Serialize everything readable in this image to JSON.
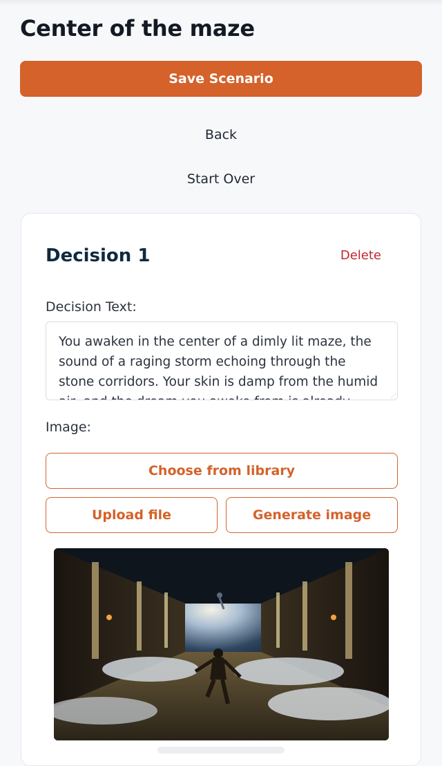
{
  "header": {
    "title": "Center of the maze"
  },
  "actions": {
    "save_label": "Save Scenario",
    "back_label": "Back",
    "start_over_label": "Start Over"
  },
  "decision": {
    "title": "Decision 1",
    "delete_label": "Delete",
    "text_label": "Decision Text:",
    "text_value": "You awaken in the center of a dimly lit maze, the sound of a raging storm echoing through the stone corridors. Your skin is damp from the humid air, and the dream you awoke from is already fading from",
    "image_label": "Image:",
    "choose_label": "Choose from library",
    "upload_label": "Upload file",
    "generate_label": "Generate image"
  },
  "colors": {
    "accent": "#d4622a",
    "danger": "#c0262d",
    "heading": "#0f2a3f",
    "background": "#f7f8fa"
  },
  "icons": {
    "textarea_resize": "resize-handle-icon"
  }
}
